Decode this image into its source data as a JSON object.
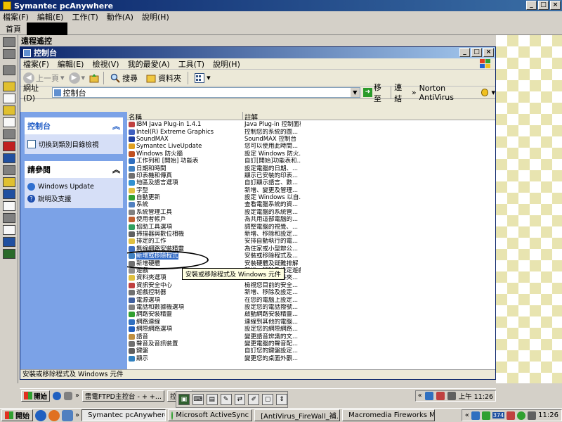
{
  "outer_window": {
    "title": "Symantec pcAnywhere",
    "menu": [
      "檔案(F)",
      "編輯(E)",
      "工作(T)",
      "動作(A)",
      "說明(H)"
    ],
    "tab_home": "首頁",
    "remote_label": "遠程遙控"
  },
  "control_panel": {
    "title": "控制台",
    "menu": [
      "檔案(F)",
      "編輯(E)",
      "檢視(V)",
      "我的最愛(A)",
      "工具(T)",
      "說明(H)"
    ],
    "toolbar": {
      "back": "上一頁",
      "search": "搜尋",
      "folders": "資料夾"
    },
    "address": {
      "label": "網址(D)",
      "value": "控制台",
      "go": "移至",
      "links": "連結",
      "norton": "Norton AntiVirus"
    },
    "task_pane": {
      "box1": {
        "title": "控制台",
        "link": "切換到類別目錄檢視"
      },
      "box2": {
        "title": "請參閱",
        "links": [
          "Windows Update",
          "說明及支援"
        ]
      }
    },
    "columns": {
      "name": "名稱",
      "comment": "註解"
    },
    "items": [
      {
        "name": "IBM Java Plug-in 1.4.1",
        "comment": "Java Plug-in 控制面板",
        "icon": "java-icon",
        "color": "#c04040"
      },
      {
        "name": "Intel(R) Extreme Graphics",
        "comment": "控制您的系統的圖...",
        "icon": "intel-icon",
        "color": "#4060c0"
      },
      {
        "name": "SoundMAX",
        "comment": "SoundMAX 控制台",
        "icon": "soundmax-icon",
        "color": "#2040a0"
      },
      {
        "name": "Symantec LiveUpdate",
        "comment": "您可以使用此時間...",
        "icon": "liveupdate-icon",
        "color": "#e0a020"
      },
      {
        "name": "Windows 防火牆",
        "comment": "設定 Windows 防火...",
        "icon": "firewall-icon",
        "color": "#c05020"
      },
      {
        "name": "工作列和 [開始] 功能表",
        "comment": "自訂[開始]功能表和...",
        "icon": "taskbar-icon",
        "color": "#3070c0"
      },
      {
        "name": "日期和時間",
        "comment": "設定電腦的日期、...",
        "icon": "clock-icon",
        "color": "#4080c0"
      },
      {
        "name": "印表機和傳真",
        "comment": "顯示已安裝的印表...",
        "icon": "printer-icon",
        "color": "#707070"
      },
      {
        "name": "地區及語言選項",
        "comment": "自訂顯示語言、數...",
        "icon": "globe-icon",
        "color": "#3090d0"
      },
      {
        "name": "字型",
        "comment": "新增、變更及管理...",
        "icon": "fonts-icon",
        "color": "#e0c040"
      },
      {
        "name": "自動更新",
        "comment": "設定 Windows 以自...",
        "icon": "update-icon",
        "color": "#30a030"
      },
      {
        "name": "系統",
        "comment": "查看電腦系統的資...",
        "icon": "system-icon",
        "color": "#5080c0"
      },
      {
        "name": "系統管理工具",
        "comment": "設定電腦的系統管...",
        "icon": "admin-tools-icon",
        "color": "#808080"
      },
      {
        "name": "使用者帳戶",
        "comment": "為共用這部電腦的...",
        "icon": "users-icon",
        "color": "#c06030"
      },
      {
        "name": "協助工具選項",
        "comment": "調整電腦的視覺、...",
        "icon": "accessibility-icon",
        "color": "#30a060"
      },
      {
        "name": "掃描器與數位相機",
        "comment": "新增、移除和設定...",
        "icon": "scanner-icon",
        "color": "#606060"
      },
      {
        "name": "排定的工作",
        "comment": "安排自動執行的電...",
        "icon": "scheduled-tasks-icon",
        "color": "#e0c040"
      },
      {
        "name": "無線網路安裝精靈",
        "comment": "為住家或小型辦公...",
        "icon": "wireless-icon",
        "color": "#4070c0"
      },
      {
        "name": "新增或移除程式",
        "comment": "安裝或移除程式及...",
        "icon": "add-remove-icon",
        "color": "#4080c0",
        "selected": true
      },
      {
        "name": "新增硬體",
        "comment": "安裝硬體及疑難排解",
        "icon": "add-hardware-icon",
        "color": "#707070"
      },
      {
        "name": "遊戲",
        "comment": "新增、移除及設定遊戲控制器",
        "icon": "game-icon",
        "color": "#909090"
      },
      {
        "name": "資料夾選項",
        "comment": "自訂檔案和資料夾...",
        "icon": "folder-icon",
        "color": "#e0c040"
      },
      {
        "name": "資訊安全中心",
        "comment": "檢視您目前的安全...",
        "icon": "shield-icon",
        "color": "#c04040"
      },
      {
        "name": "遊戲控制器",
        "comment": "新增、移除及設定...",
        "icon": "gamepad-icon",
        "color": "#707070"
      },
      {
        "name": "電源選項",
        "comment": "在您的電腦上設定...",
        "icon": "power-icon",
        "color": "#4060a0"
      },
      {
        "name": "電話和數據機選項",
        "comment": "設定您的電話撥號...",
        "icon": "phone-icon",
        "color": "#808080"
      },
      {
        "name": "網路安裝精靈",
        "comment": "啟動網路安裝精靈...",
        "icon": "network-setup-icon",
        "color": "#30a030"
      },
      {
        "name": "網路連線",
        "comment": "連線到其他的電腦...",
        "icon": "network-icon",
        "color": "#3070c0"
      },
      {
        "name": "網際網路選項",
        "comment": "設定您的網際網路...",
        "icon": "ie-icon",
        "color": "#2060c0"
      },
      {
        "name": "語音",
        "comment": "變更語音辨識的文...",
        "icon": "speech-icon",
        "color": "#c09040"
      },
      {
        "name": "聲音及音訊裝置",
        "comment": "變更電腦的聲音配...",
        "icon": "sound-icon",
        "color": "#707070"
      },
      {
        "name": "鍵盤",
        "comment": "自訂您的鍵盤設定...",
        "icon": "keyboard-icon",
        "color": "#606060"
      },
      {
        "name": "顯示",
        "comment": "變更您的桌面外觀...",
        "icon": "display-icon",
        "color": "#3080c0"
      }
    ],
    "tooltip": "安裝或移除程式及 Windows 元件",
    "status": "安裝或移除程式及 Windows 元件"
  },
  "remote_taskbar": {
    "start": "開始",
    "task1": "雷電FTPD主控台 - + +...",
    "task2": "控制台",
    "clock": "上午 11:26"
  },
  "local_taskbar": {
    "start": "開始",
    "tasks": [
      "Symantec pcAnywhere",
      "Microsoft ActiveSync",
      "[AntiVirus_FireWall_補...",
      "Macromedia Fireworks M..."
    ],
    "tray_number": "374",
    "clock": "11:26"
  }
}
